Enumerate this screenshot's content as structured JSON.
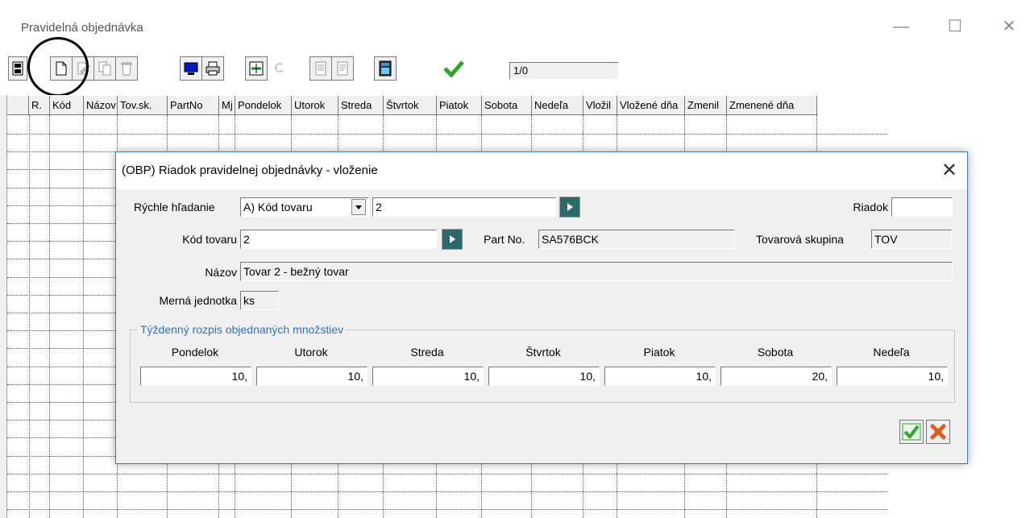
{
  "window": {
    "title": "Pravidelná objednávka",
    "minimize_glyph": "—",
    "maximize_glyph": "☐",
    "close_glyph": "✕"
  },
  "toolbar": {
    "record_counter": "1/0",
    "buttons": [
      "exit-icon",
      "new-document-icon",
      "edit-icon",
      "copy-icon",
      "delete-icon",
      "monitor-icon",
      "print-icon",
      "transfer-icon",
      "refresh-icon",
      "export-icon",
      "import-icon",
      "calculator-icon",
      "confirm-check-icon"
    ]
  },
  "grid": {
    "columns": [
      "R.",
      "Kód",
      "Názov",
      "Tov.sk.",
      "PartNo",
      "Mj",
      "Pondelok",
      "Utorok",
      "Streda",
      "Štvrtok",
      "Piatok",
      "Sobota",
      "Nedeľa",
      "Vložil",
      "Vložené dňa",
      "Zmenil",
      "Zmenené dňa"
    ],
    "rows": []
  },
  "dialog": {
    "title": "(OBP) Riadok pravidelnej objednávky - vloženie",
    "close_glyph": "✕",
    "quick_search_label": "Rýchle hľadanie",
    "quick_search_mode": "A) Kód tovaru",
    "quick_search_value": "2",
    "row_label": "Riadok",
    "row_value": "",
    "item_code_label": "Kód tovaru",
    "item_code_value": "2",
    "part_no_label": "Part No.",
    "part_no_value": "SA576BCK",
    "product_group_label": "Tovarová skupina",
    "product_group_value": "TOV",
    "name_label": "Názov",
    "name_value": "Tovar 2 - bežný tovar",
    "unit_label": "Merná jednotka",
    "unit_value": "ks",
    "weekly_group_title": "Týždenný rozpis objednaných množstiev",
    "days": [
      {
        "label": "Pondelok",
        "value": "10,"
      },
      {
        "label": "Utorok",
        "value": "10,"
      },
      {
        "label": "Streda",
        "value": "10,"
      },
      {
        "label": "Štvrtok",
        "value": "10,"
      },
      {
        "label": "Piatok",
        "value": "10,"
      },
      {
        "label": "Sobota",
        "value": "20,"
      },
      {
        "label": "Nedeľa",
        "value": "10,"
      }
    ],
    "colors": {
      "go_button": "#2b6a6c",
      "group_title": "#2a73c9",
      "ok_green": "#2ea62e",
      "cancel_red": "#e05a1e"
    }
  }
}
